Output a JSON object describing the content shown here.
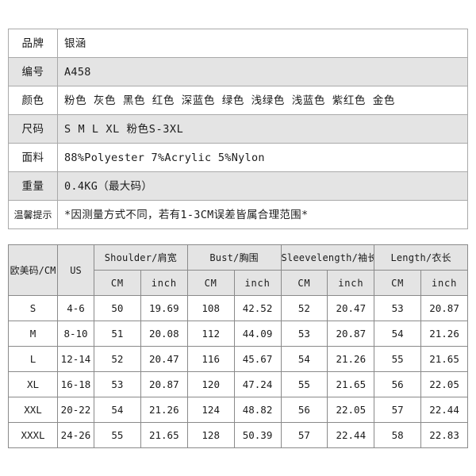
{
  "attributes_table": {
    "rows": [
      {
        "label": "品牌",
        "value": "银涵"
      },
      {
        "label": "编号",
        "value": "A458"
      },
      {
        "label": "颜色",
        "value": "粉色 灰色 黑色 红色 深蓝色 绿色 浅绿色 浅蓝色 紫红色 金色"
      },
      {
        "label": "尺码",
        "value": "S M L XL  粉色S-3XL"
      },
      {
        "label": "面料",
        "value": "88%Polyester  7%Acrylic  5%Nylon"
      },
      {
        "label": "重量",
        "value": "0.4KG（最大码）"
      },
      {
        "label": "温馨提示",
        "value": "*因测量方式不同，若有1-3CM误差皆属合理范围*"
      }
    ]
  },
  "size_table": {
    "group_headers": [
      "欧美码/CM",
      "US",
      "Shoulder/肩宽",
      "Bust/胸围",
      "Sleevelength/袖长",
      "Length/衣长"
    ],
    "unit_headers": [
      "",
      "",
      "CM",
      "inch",
      "CM",
      "inch",
      "CM",
      "inch",
      "CM",
      "inch"
    ],
    "rows": [
      {
        "size": "S",
        "us": "4-6",
        "shoulder_cm": "50",
        "shoulder_in": "19.69",
        "bust_cm": "108",
        "bust_in": "42.52",
        "sleeve_cm": "52",
        "sleeve_in": "20.47",
        "length_cm": "53",
        "length_in": "20.87"
      },
      {
        "size": "M",
        "us": "8-10",
        "shoulder_cm": "51",
        "shoulder_in": "20.08",
        "bust_cm": "112",
        "bust_in": "44.09",
        "sleeve_cm": "53",
        "sleeve_in": "20.87",
        "length_cm": "54",
        "length_in": "21.26"
      },
      {
        "size": "L",
        "us": "12-14",
        "shoulder_cm": "52",
        "shoulder_in": "20.47",
        "bust_cm": "116",
        "bust_in": "45.67",
        "sleeve_cm": "54",
        "sleeve_in": "21.26",
        "length_cm": "55",
        "length_in": "21.65"
      },
      {
        "size": "XL",
        "us": "16-18",
        "shoulder_cm": "53",
        "shoulder_in": "20.87",
        "bust_cm": "120",
        "bust_in": "47.24",
        "sleeve_cm": "55",
        "sleeve_in": "21.65",
        "length_cm": "56",
        "length_in": "22.05"
      },
      {
        "size": "XXL",
        "us": "20-22",
        "shoulder_cm": "54",
        "shoulder_in": "21.26",
        "bust_cm": "124",
        "bust_in": "48.82",
        "sleeve_cm": "56",
        "sleeve_in": "22.05",
        "length_cm": "57",
        "length_in": "22.44"
      },
      {
        "size": "XXXL",
        "us": "24-26",
        "shoulder_cm": "55",
        "shoulder_in": "21.65",
        "bust_cm": "128",
        "bust_in": "50.39",
        "sleeve_cm": "57",
        "sleeve_in": "22.44",
        "length_cm": "58",
        "length_in": "22.83"
      }
    ]
  },
  "colors": {
    "shade_row": "#e4e4e4",
    "plain_row": "#ffffff",
    "border_light": "#a9a9a9",
    "border_dark": "#8a8a8a",
    "text": "#1b1b1b",
    "page_background": "#ffffff"
  }
}
